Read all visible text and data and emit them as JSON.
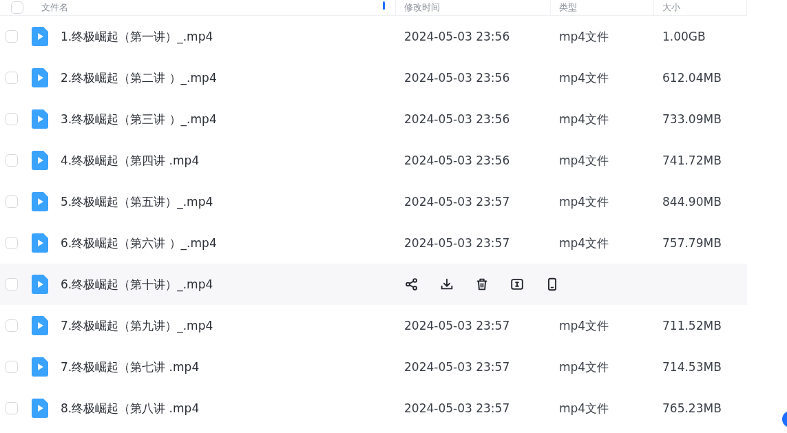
{
  "table": {
    "select_all_checked": false,
    "columns": [
      {
        "label": "文件名",
        "sorted": true
      },
      {
        "label": "修改时间",
        "sorted": false
      },
      {
        "label": "类型",
        "sorted": false
      },
      {
        "label": "大小",
        "sorted": false
      }
    ],
    "rows": [
      {
        "name": "1.终极崛起（第一讲）_.mp4",
        "modified": "2024-05-03 23:56",
        "type": "mp4文件",
        "size": "1.00GB",
        "hovered": false
      },
      {
        "name": "2.终极崛起（第二讲 ）_.mp4",
        "modified": "2024-05-03 23:56",
        "type": "mp4文件",
        "size": "612.04MB",
        "hovered": false
      },
      {
        "name": "3.终极崛起（第三讲 ）_.mp4",
        "modified": "2024-05-03 23:56",
        "type": "mp4文件",
        "size": "733.09MB",
        "hovered": false
      },
      {
        "name": "4.终极崛起（第四讲 .mp4",
        "modified": "2024-05-03 23:56",
        "type": "mp4文件",
        "size": "741.72MB",
        "hovered": false
      },
      {
        "name": "5.终极崛起（第五讲）_.mp4",
        "modified": "2024-05-03 23:57",
        "type": "mp4文件",
        "size": "844.90MB",
        "hovered": false
      },
      {
        "name": "6.终极崛起（第六讲 ）_.mp4",
        "modified": "2024-05-03 23:57",
        "type": "mp4文件",
        "size": "757.79MB",
        "hovered": false
      },
      {
        "name": "6.终极崛起（第十讲）_.mp4",
        "hovered": true
      },
      {
        "name": "7.终极崛起（第九讲）_.mp4",
        "modified": "2024-05-03 23:57",
        "type": "mp4文件",
        "size": "711.52MB",
        "hovered": false
      },
      {
        "name": "7.终极崛起（第七讲 .mp4",
        "modified": "2024-05-03 23:57",
        "type": "mp4文件",
        "size": "714.53MB",
        "hovered": false
      },
      {
        "name": "8.终极崛起（第八讲 .mp4",
        "modified": "2024-05-03 23:57",
        "type": "mp4文件",
        "size": "765.23MB",
        "hovered": false
      }
    ]
  }
}
